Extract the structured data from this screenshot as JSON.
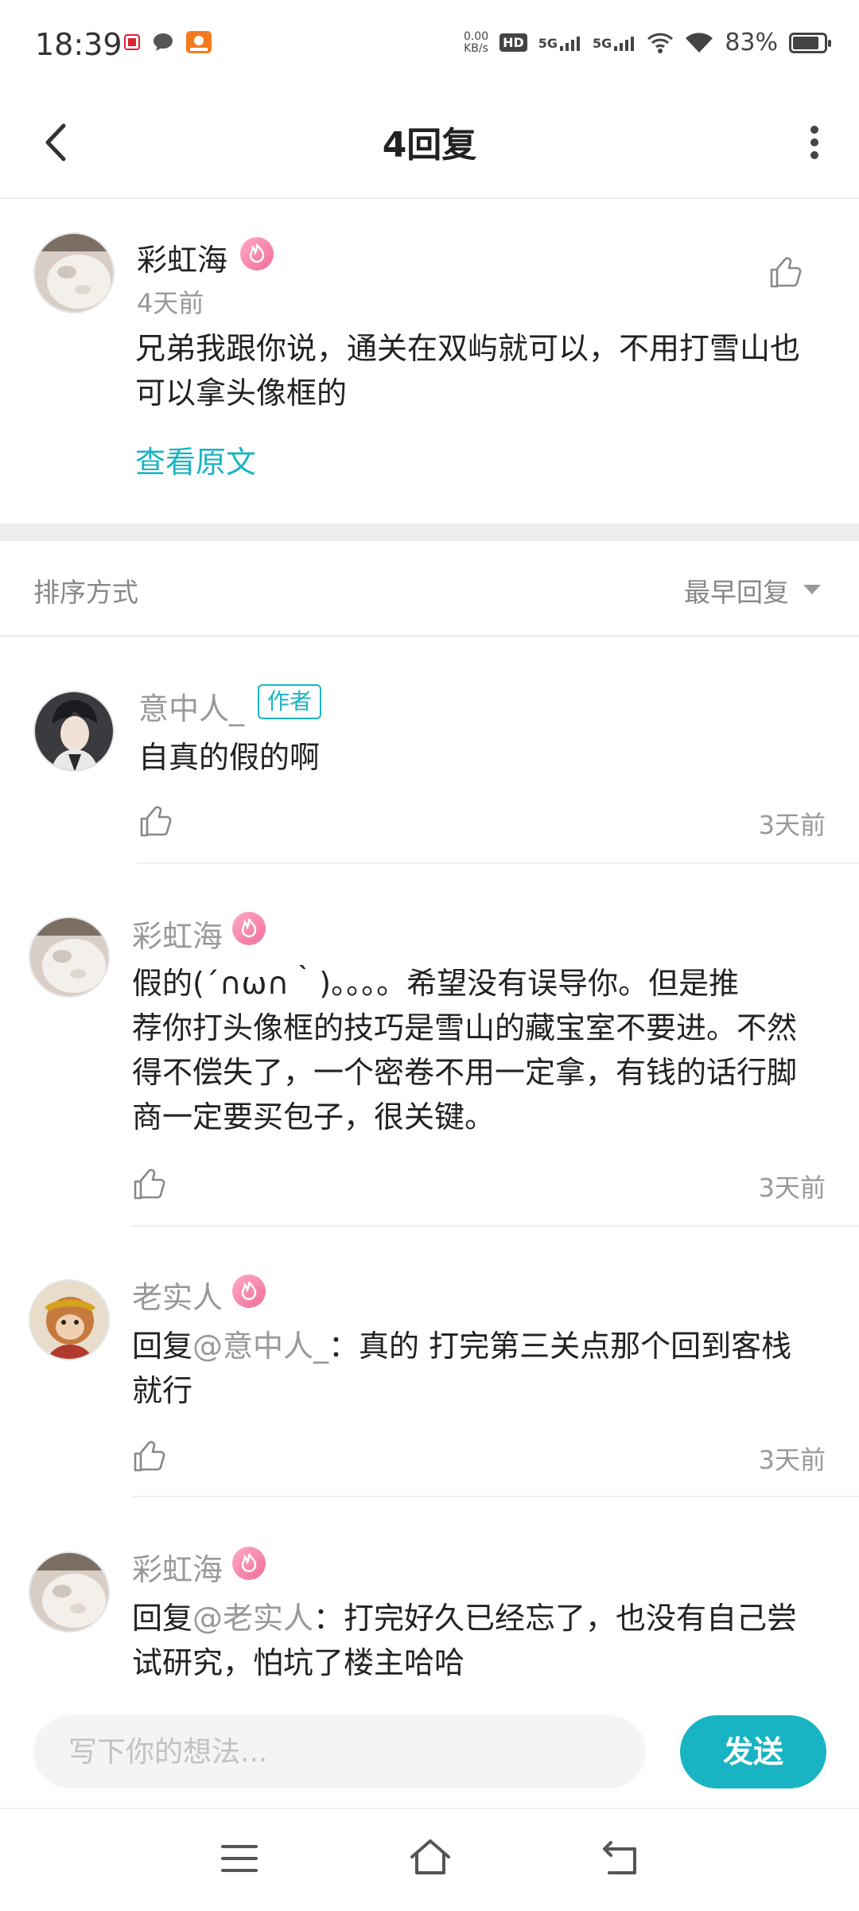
{
  "status": {
    "time": "18:39",
    "net_speed_value": "0.00",
    "net_speed_unit": "KB/s",
    "hd_label": "HD",
    "signal1": "5G",
    "signal2": "5G",
    "battery": "83%",
    "battery_level": 0.83
  },
  "header": {
    "title": "4回复"
  },
  "post": {
    "author": "彩虹海",
    "time": "4天前",
    "content_line1": "兄弟我跟你说，通关在双屿就可以，不用打雪山也",
    "content_line2": "可以拿头像框的",
    "view_original": "查看原文"
  },
  "sort": {
    "label": "排序方式",
    "value": "最早回复"
  },
  "replies": [
    {
      "author": "意中人_",
      "tag": "作者",
      "lines": [
        "自真的假的啊"
      ],
      "time": "3天前"
    },
    {
      "author": "彩虹海",
      "lines": [
        "假的(´∩ω∩｀)。。。。希望没有误导你。但是推",
        "荐你打头像框的技巧是雪山的藏宝室不要进。不然",
        "得不偿失了，一个密卷不用一定拿，有钱的话行脚",
        "商一定要买包子，很关键。"
      ],
      "time": "3天前"
    },
    {
      "author": "老实人",
      "reply_prefix": "回复",
      "mention": "@意中人_",
      "line1_rest": "：真的  打完第三关点那个回到客栈",
      "line2": "就行",
      "time": "3天前"
    },
    {
      "author": "彩虹海",
      "reply_prefix": "回复",
      "mention": "@老实人",
      "line1_rest": "：打完好久已经忘了，也没有自己尝",
      "line2": "试研究，怕坑了楼主哈哈"
    }
  ],
  "composer": {
    "placeholder": "写下你的想法...",
    "send": "发送"
  },
  "icons": {
    "back": "back-arrow-icon",
    "more": "more-vertical-icon",
    "like": "thumbs-up-icon",
    "fire": "fire-badge-icon"
  },
  "colors": {
    "accent": "#19b4c4",
    "badge": "#ef6e9a",
    "muted": "#999999"
  }
}
